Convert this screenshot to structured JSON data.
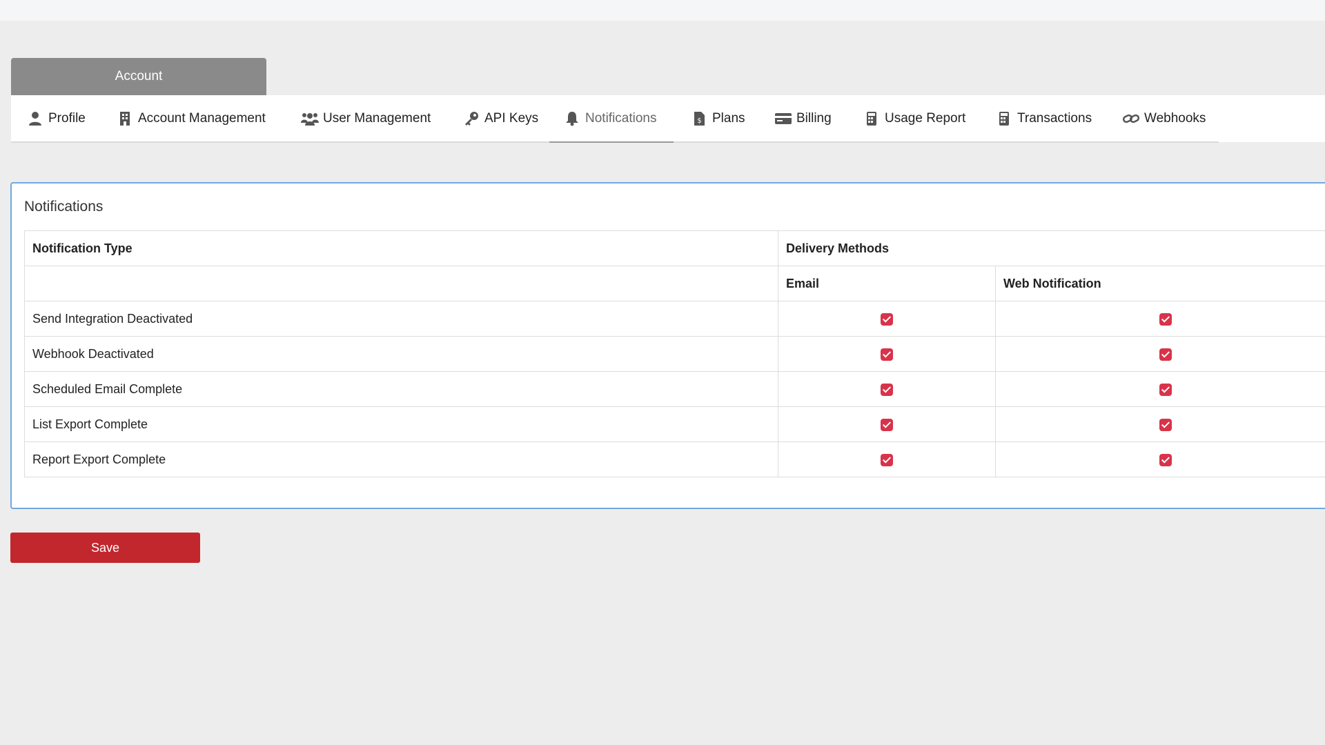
{
  "header": {
    "account_tab": "Account"
  },
  "nav": {
    "items": [
      {
        "label": "Profile",
        "icon": "user-icon"
      },
      {
        "label": "Account Management",
        "icon": "building-icon"
      },
      {
        "label": "User Management",
        "icon": "users-icon"
      },
      {
        "label": "API Keys",
        "icon": "key-icon"
      },
      {
        "label": "Notifications",
        "icon": "bell-icon",
        "active": true
      },
      {
        "label": "Plans",
        "icon": "file-dollar-icon"
      },
      {
        "label": "Billing",
        "icon": "credit-card-icon"
      },
      {
        "label": "Usage Report",
        "icon": "calculator-icon"
      },
      {
        "label": "Transactions",
        "icon": "calculator-icon"
      },
      {
        "label": "Webhooks",
        "icon": "link-icon"
      }
    ]
  },
  "panel": {
    "title": "Notifications",
    "table": {
      "col_type": "Notification Type",
      "col_delivery": "Delivery Methods",
      "sub_email": "Email",
      "sub_web": "Web Notification",
      "rows": [
        {
          "type": "Send Integration Deactivated",
          "email": true,
          "web": true
        },
        {
          "type": "Webhook Deactivated",
          "email": true,
          "web": true
        },
        {
          "type": "Scheduled Email Complete",
          "email": true,
          "web": true
        },
        {
          "type": "List Export Complete",
          "email": true,
          "web": true
        },
        {
          "type": "Report Export Complete",
          "email": true,
          "web": true
        }
      ]
    }
  },
  "actions": {
    "save_label": "Save"
  },
  "colors": {
    "accent": "#c1272d",
    "checkbox": "#d9334a",
    "panel_border": "#6fa8e0",
    "tab_bg": "#8a8a8a"
  }
}
